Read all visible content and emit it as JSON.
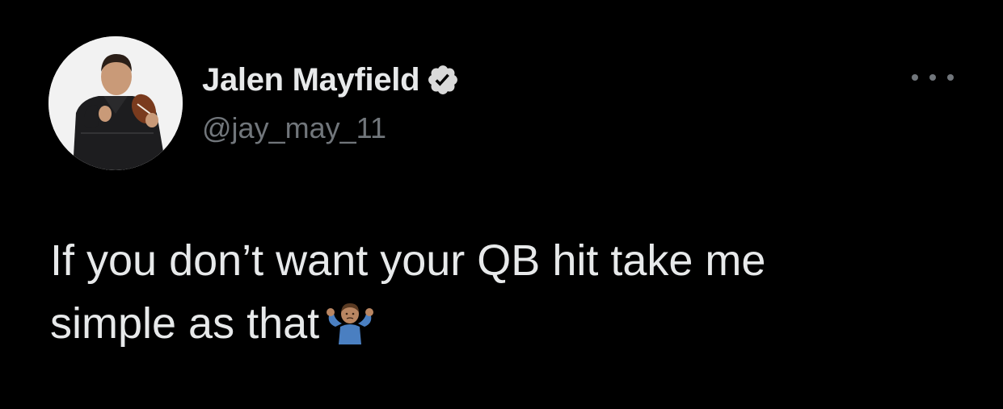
{
  "tweet": {
    "author": {
      "display_name": "Jalen Mayfield",
      "handle": "@jay_may_11",
      "verified": true
    },
    "text_lines": [
      "If you don’t want your QB hit take me",
      "simple as that"
    ],
    "emoji": "person-shrugging-emoji",
    "more_icon": "more-horizontal-icon"
  },
  "colors": {
    "background": "#000000",
    "primary_text": "#e7e9ea",
    "secondary_text": "#71767b",
    "verified_badge": "#d9d9d9"
  }
}
